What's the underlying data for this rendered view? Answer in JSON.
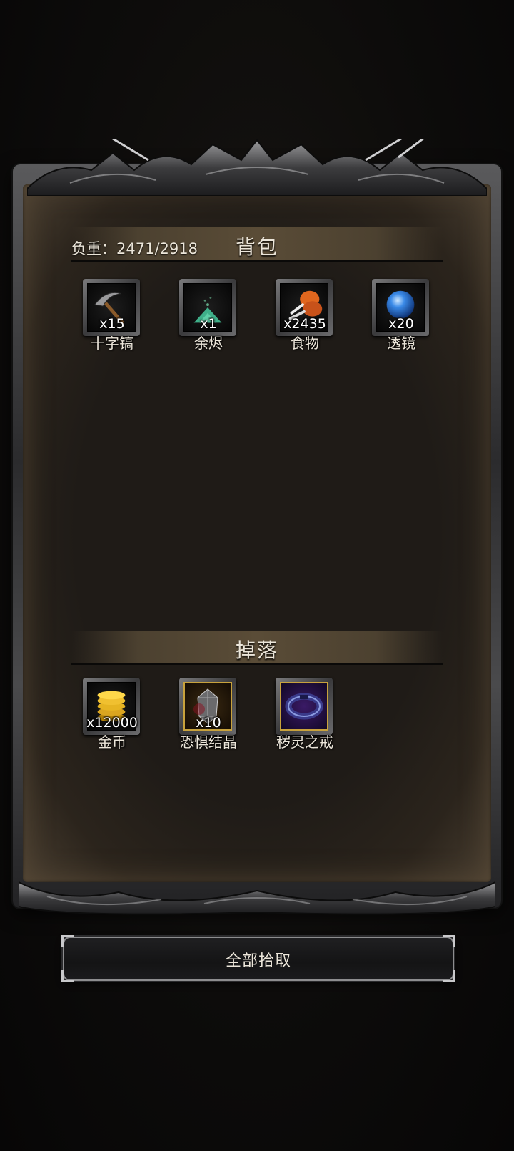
{
  "backpack": {
    "weight_text": "负重：2471/2918",
    "title": "背包",
    "items": [
      {
        "name": "十字镐",
        "count": "x15",
        "icon": "pickaxe-icon"
      },
      {
        "name": "余烬",
        "count": "x1",
        "icon": "ember-icon"
      },
      {
        "name": "食物",
        "count": "x2435",
        "icon": "food-drumstick-icon"
      },
      {
        "name": "透镜",
        "count": "x20",
        "icon": "lens-orb-icon"
      }
    ]
  },
  "drops": {
    "title": "掉落",
    "items": [
      {
        "name": "金币",
        "count": "x12000",
        "icon": "gold-coins-icon"
      },
      {
        "name": "恐惧结晶",
        "count": "x10",
        "icon": "fear-crystal-icon"
      },
      {
        "name": "秽灵之戒",
        "count": "",
        "icon": "ring-icon"
      }
    ]
  },
  "collect_all_label": "全部拾取",
  "colors": {
    "panel_bg": "#1f1b17",
    "header_band": "#5a4c37",
    "rare_border": "#c8a23c",
    "text": "#ece6da"
  }
}
